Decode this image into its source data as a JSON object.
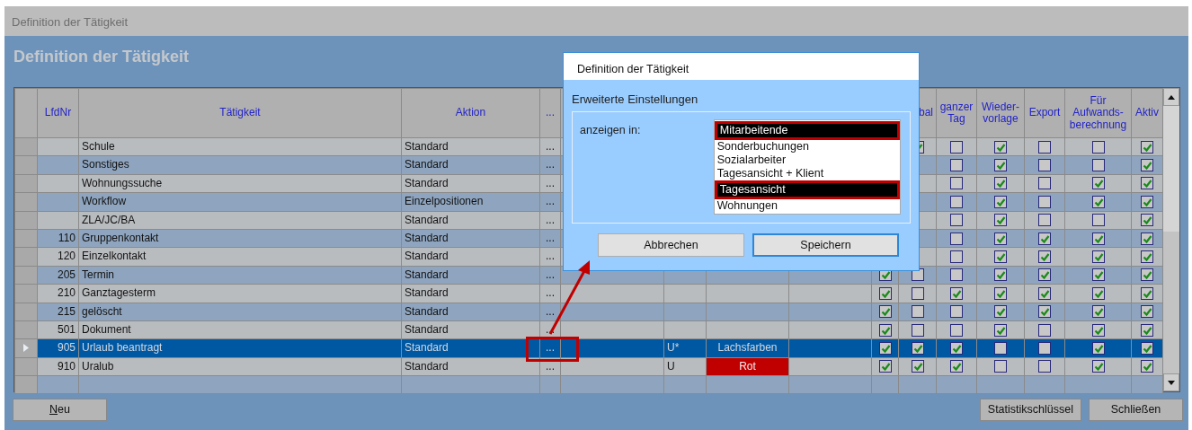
{
  "window": {
    "title": "Definition der Tätigkeit"
  },
  "page_title": "Definition der Tätigkeit",
  "table": {
    "columns": [
      {
        "label": "LfdNr"
      },
      {
        "label": "Tätigkeit"
      },
      {
        "label": "Aktion"
      },
      {
        "label": "..."
      },
      {},
      {},
      {},
      {},
      {},
      {
        "label": "bal"
      },
      {
        "label": "ganzer\nTag"
      },
      {
        "label": "Wieder-\nvorlage"
      },
      {
        "label": "Export"
      },
      {
        "label": "Für\nAufwands-\nberechnung"
      },
      {
        "label": "Aktiv"
      }
    ],
    "rows": [
      {
        "lfdnr": "",
        "name": "Schule",
        "aktion": "Standard",
        "dots": "...",
        "selected": false,
        "checks": {
          "bal": true,
          "ganzer_tag": false,
          "wiedervorlage": true,
          "export": false,
          "aufwandsberechnung": false,
          "aktiv": true
        }
      },
      {
        "lfdnr": "",
        "name": "Sonstiges",
        "aktion": "Standard",
        "dots": "...",
        "selected": false,
        "checks": {
          "ganzer_tag": false,
          "wiedervorlage": true,
          "export": false,
          "aufwandsberechnung": false,
          "aktiv": true
        }
      },
      {
        "lfdnr": "",
        "name": "Wohnungssuche",
        "aktion": "Standard",
        "dots": "...",
        "selected": false,
        "checks": {
          "ganzer_tag": false,
          "wiedervorlage": true,
          "export": false,
          "aufwandsberechnung": true,
          "aktiv": true
        }
      },
      {
        "lfdnr": "",
        "name": "Workflow",
        "aktion": "Einzelpositionen",
        "dots": "...",
        "selected": false,
        "checks": {
          "ganzer_tag": false,
          "wiedervorlage": true,
          "export": false,
          "aufwandsberechnung": true,
          "aktiv": true
        }
      },
      {
        "lfdnr": "",
        "name": "ZLA/JC/BA",
        "aktion": "Standard",
        "dots": "...",
        "selected": false,
        "checks": {
          "ganzer_tag": false,
          "wiedervorlage": true,
          "export": false,
          "aufwandsberechnung": false,
          "aktiv": true
        }
      },
      {
        "lfdnr": "110",
        "name": "Gruppenkontakt",
        "aktion": "Standard",
        "dots": "...",
        "selected": false,
        "checks": {
          "ganzer_tag": false,
          "wiedervorlage": true,
          "export": true,
          "aufwandsberechnung": true,
          "aktiv": true
        }
      },
      {
        "lfdnr": "120",
        "name": "Einzelkontakt",
        "aktion": "Standard",
        "dots": "...",
        "selected": false,
        "checks": {
          "ganzer_tag": false,
          "wiedervorlage": true,
          "export": true,
          "aufwandsberechnung": true,
          "aktiv": true
        }
      },
      {
        "lfdnr": "205",
        "name": "Termin",
        "aktion": "Standard",
        "dots": "...",
        "selected": false,
        "checks": {
          "column_9": true,
          "bal": false,
          "ganzer_tag": false,
          "wiedervorlage": true,
          "export": true,
          "aufwandsberechnung": true,
          "aktiv": true
        }
      },
      {
        "lfdnr": "210",
        "name": "Ganztagesterm",
        "aktion": "Standard",
        "dots": "...",
        "selected": false,
        "checks": {
          "column_9": true,
          "bal": false,
          "ganzer_tag": true,
          "wiedervorlage": true,
          "export": true,
          "aufwandsberechnung": true,
          "aktiv": true
        }
      },
      {
        "lfdnr": "215",
        "name": "gelöscht",
        "aktion": "Standard",
        "dots": "...",
        "selected": false,
        "checks": {
          "column_9": true,
          "bal": false,
          "ganzer_tag": false,
          "wiedervorlage": true,
          "export": true,
          "aufwandsberechnung": true,
          "aktiv": true
        }
      },
      {
        "lfdnr": "501",
        "name": "Dokument",
        "aktion": "Standard",
        "dots": "...",
        "selected": false,
        "checks": {
          "column_9": true,
          "bal": false,
          "ganzer_tag": false,
          "wiedervorlage": true,
          "export": false,
          "aufwandsberechnung": true,
          "aktiv": true
        }
      },
      {
        "lfdnr": "905",
        "name": "Urlaub beantragt",
        "aktion": "Standard",
        "dots": "...",
        "dots_highlighted": true,
        "kuerzel": "U*",
        "farbe": {
          "label": "Lachsfarben"
        },
        "selected": true,
        "checks": {
          "column_9": true,
          "bal": true,
          "ganzer_tag": true,
          "wiedervorlage": false,
          "export": false,
          "aufwandsberechnung": true,
          "aktiv": true
        }
      },
      {
        "lfdnr": "910",
        "name": "Uralub",
        "aktion": "Standard",
        "dots": "...",
        "kuerzel": "U",
        "farbe": {
          "label": "Rot",
          "color": "#c00000"
        },
        "selected": false,
        "checks": {
          "column_9": true,
          "bal": true,
          "ganzer_tag": true,
          "wiedervorlage": false,
          "export": false,
          "aufwandsberechnung": true,
          "aktiv": true
        }
      }
    ]
  },
  "dialog": {
    "title": "Definition der Tätigkeit",
    "heading": "Erweiterte Einstellungen",
    "field_label": "anzeigen in:",
    "options": [
      {
        "label": "Mitarbeitende",
        "selected": true,
        "highlighted": true
      },
      {
        "label": "Sonderbuchungen",
        "selected": false,
        "highlighted": false
      },
      {
        "label": "Sozialarbeiter",
        "selected": false,
        "highlighted": false
      },
      {
        "label": "Tagesansicht + Klient",
        "selected": false,
        "highlighted": false
      },
      {
        "label": "Tagesansicht",
        "selected": true,
        "highlighted": true
      },
      {
        "label": "Wohnungen",
        "selected": false,
        "highlighted": false
      }
    ],
    "buttons": [
      {
        "label": "Abbrechen",
        "default": false
      },
      {
        "label": "Speichern",
        "default": true
      }
    ]
  },
  "footer": {
    "left_buttons": [
      {
        "label": "Neu",
        "underline_first": true
      }
    ],
    "right_buttons": [
      {
        "label": "Statistikschlüssel",
        "underline_first": false
      },
      {
        "label": "Schließen",
        "underline_first": false
      }
    ]
  }
}
